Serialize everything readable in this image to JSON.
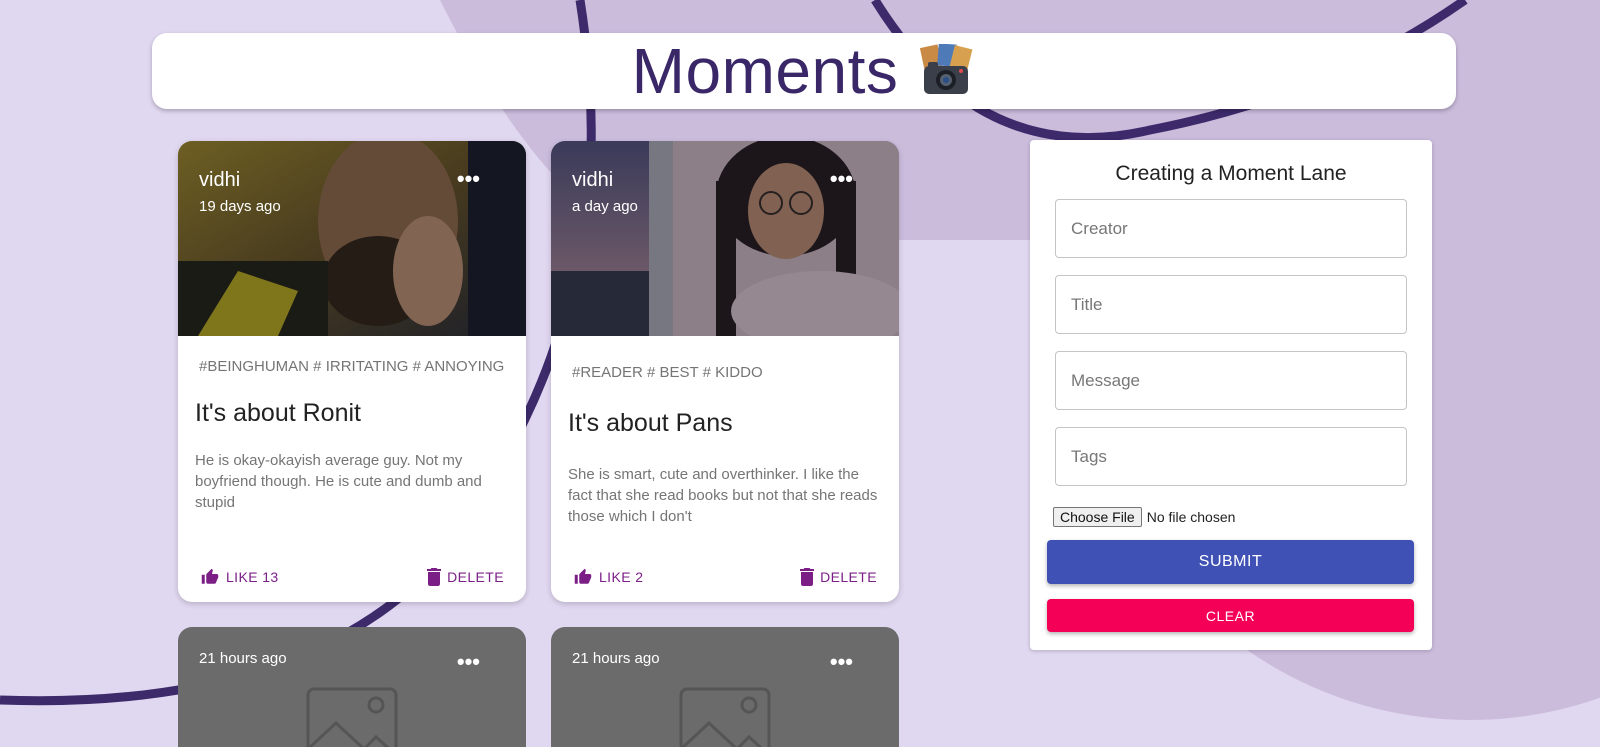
{
  "app": {
    "title": "Moments",
    "logo_icon": "camera-photos-icon"
  },
  "posts": [
    {
      "creator": "vidhi",
      "time": "19 days ago",
      "tags": "#BEINGHUMAN # IRRITATING # ANNOYING",
      "title": "It's about Ronit",
      "message": "He is okay-okayish average guy. Not my boyfriend though. He is cute and dumb and stupid",
      "like_label": "LIKE 13",
      "delete_label": "DELETE",
      "more_label": "•••"
    },
    {
      "creator": "vidhi",
      "time": "a day ago",
      "tags": "#READER # BEST # KIDDO",
      "title": "It's about Pans",
      "message": "She is smart, cute and overthinker. I like the fact that she read books but not that she reads those which I don't",
      "like_label": "LIKE 2",
      "delete_label": "DELETE",
      "more_label": "•••"
    },
    {
      "time": "21 hours ago",
      "more_label": "•••"
    },
    {
      "time": "21 hours ago",
      "more_label": "•••"
    }
  ],
  "form": {
    "heading": "Creating a Moment Lane",
    "creator_placeholder": "Creator",
    "title_placeholder": "Title",
    "message_placeholder": "Message",
    "tags_placeholder": "Tags",
    "choose_file_label": "Choose File",
    "no_file_label": "No file chosen",
    "submit_label": "SUBMIT",
    "clear_label": "CLEAR"
  },
  "colors": {
    "background": "#e0d7f0",
    "title": "#3a2768",
    "action": "#7b1f87",
    "submit": "#3f51b5",
    "clear": "#f50057"
  }
}
